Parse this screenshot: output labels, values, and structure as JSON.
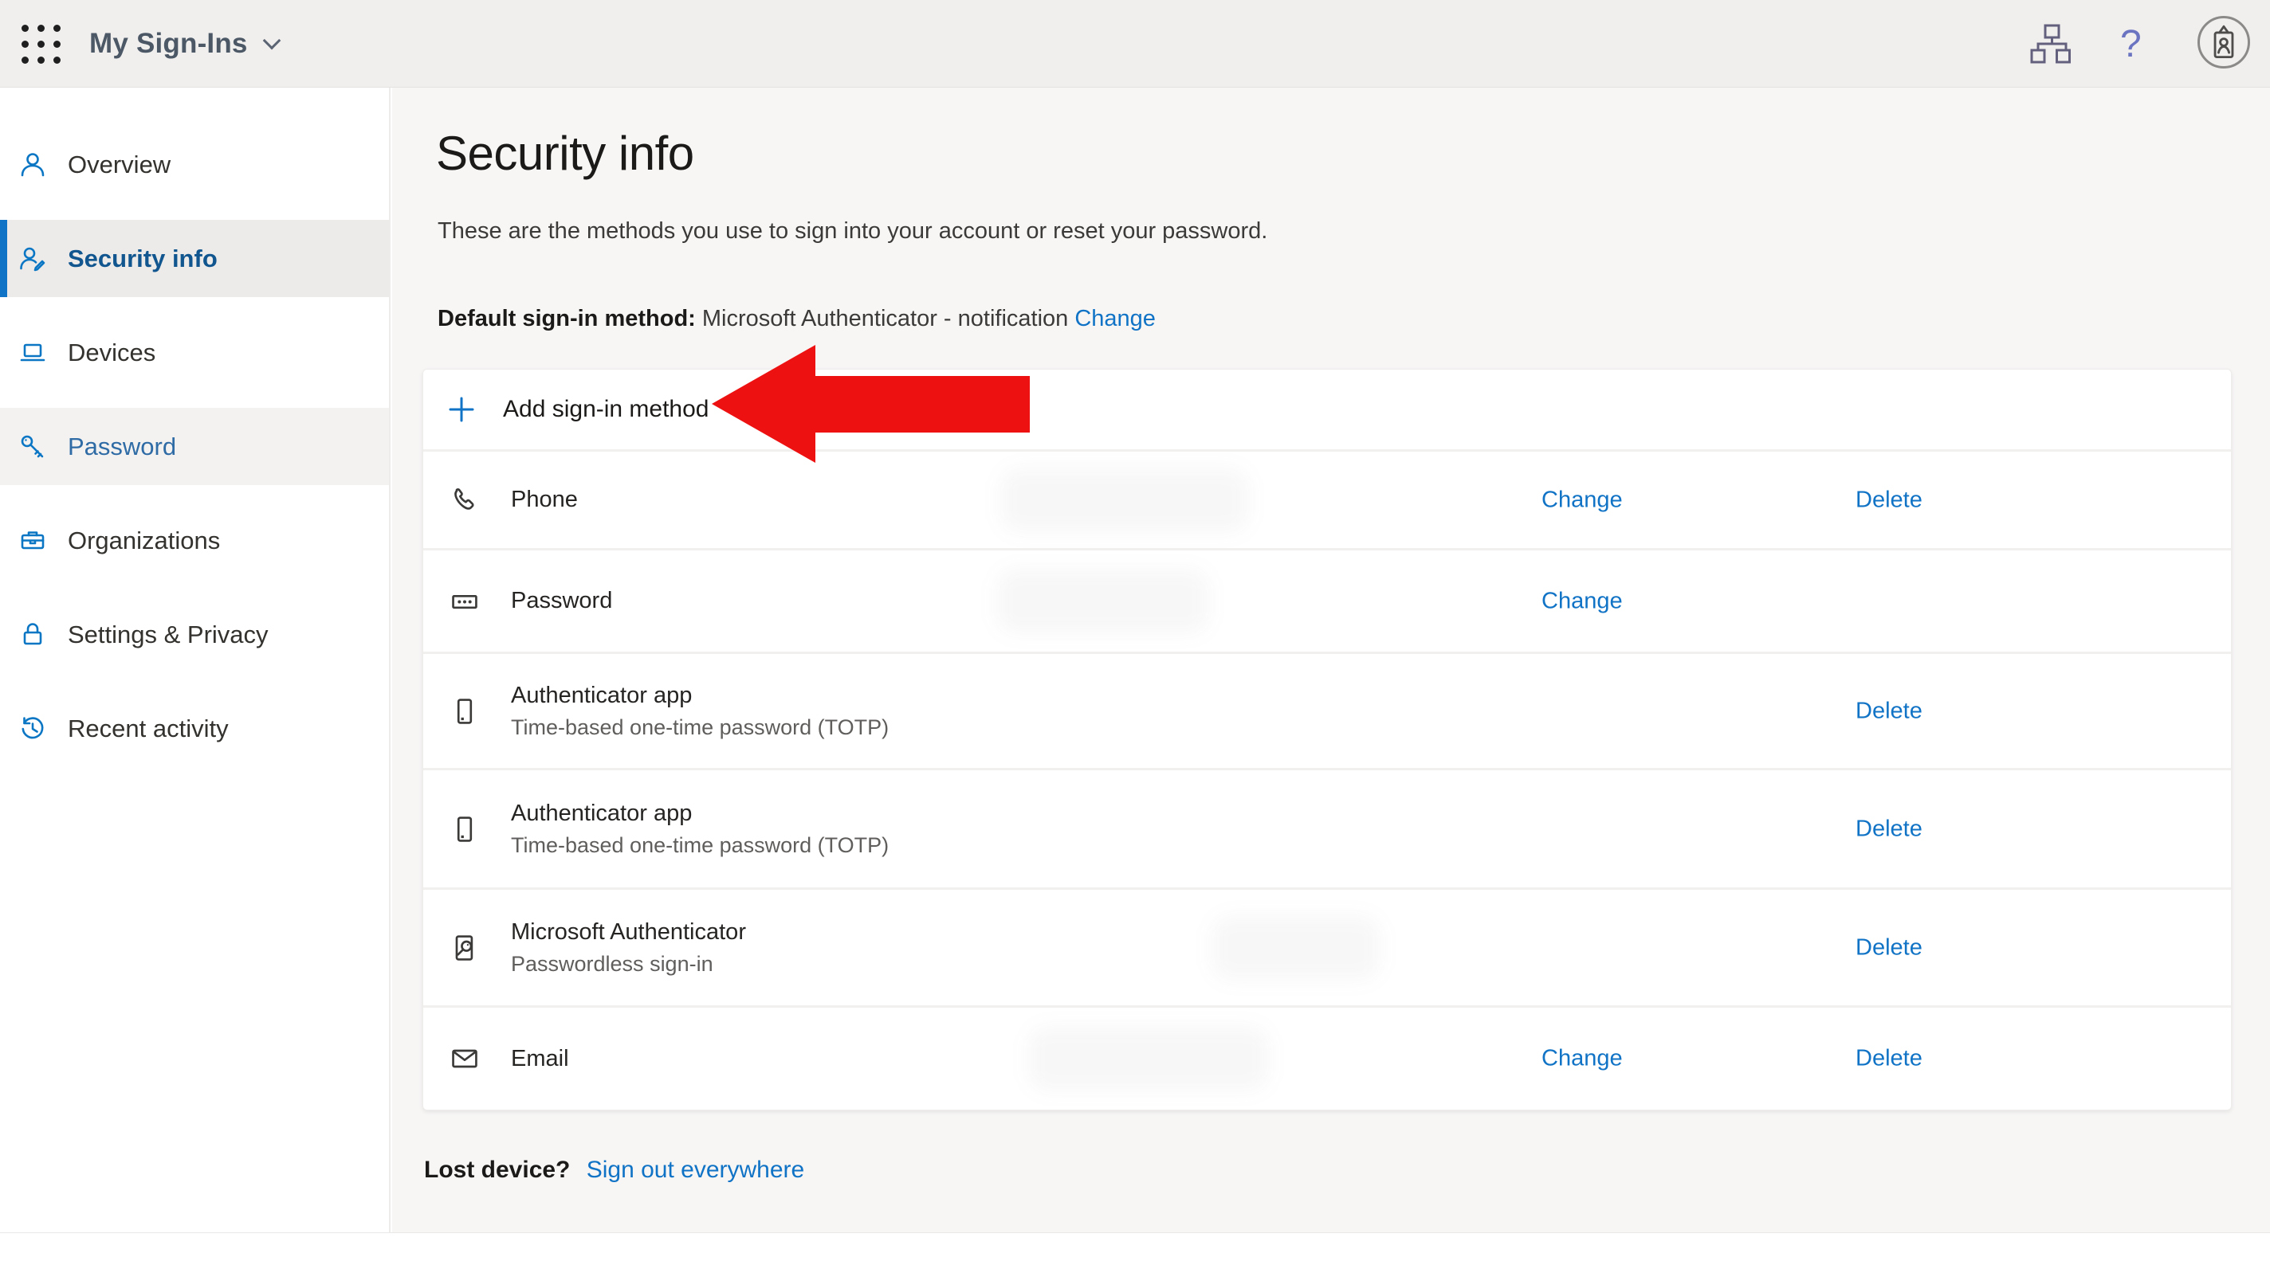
{
  "topbar": {
    "app_title": "My Sign-Ins",
    "icons": {
      "app_launcher": "grid-of-9-dots",
      "chevron": "chevron-down",
      "org_chart": "hierarchy-squares",
      "help": "?",
      "avatar": "id-badge-in-circle"
    }
  },
  "sidebar": {
    "items": [
      {
        "label": "Overview",
        "icon": "person-icon",
        "state": "normal"
      },
      {
        "label": "Security info",
        "icon": "person-key-icon",
        "state": "active"
      },
      {
        "label": "Devices",
        "icon": "laptop-icon",
        "state": "normal"
      },
      {
        "label": "Password",
        "icon": "key-icon",
        "state": "hovered"
      },
      {
        "label": "Organizations",
        "icon": "briefcase-icon",
        "state": "normal"
      },
      {
        "label": "Settings & Privacy",
        "icon": "lock-icon",
        "state": "normal"
      },
      {
        "label": "Recent activity",
        "icon": "history-icon",
        "state": "normal"
      }
    ]
  },
  "main": {
    "title": "Security info",
    "subtitle": "These are the methods you use to sign into your account or reset your password.",
    "default_line": {
      "label": "Default sign-in method:",
      "value": "Microsoft Authenticator - notification",
      "change_label": "Change"
    },
    "add_label": "Add sign-in method",
    "actions": {
      "change": "Change",
      "delete": "Delete"
    },
    "methods": [
      {
        "title": "Phone",
        "icon": "phone-icon",
        "actions": [
          "Change",
          "Delete"
        ],
        "value_redacted": true
      },
      {
        "title": "Password",
        "icon": "password-dots-icon",
        "actions": [
          "Change"
        ],
        "value_redacted": true
      },
      {
        "title": "Authenticator app",
        "subtitle": "Time-based one-time password (TOTP)",
        "icon": "mobile-phone-icon",
        "actions": [
          "Delete"
        ],
        "value_redacted": false
      },
      {
        "title": "Authenticator app",
        "subtitle": "Time-based one-time password (TOTP)",
        "icon": "mobile-phone-icon",
        "actions": [
          "Delete"
        ],
        "value_redacted": false
      },
      {
        "title": "Microsoft Authenticator",
        "subtitle": "Passwordless sign-in",
        "icon": "passwordless-device-icon",
        "actions": [
          "Delete"
        ],
        "value_redacted": true
      },
      {
        "title": "Email",
        "icon": "envelope-icon",
        "actions": [
          "Change",
          "Delete"
        ],
        "value_redacted": true
      }
    ],
    "lost_device": {
      "label": "Lost device?",
      "link_label": "Sign out everywhere"
    }
  },
  "annotation": {
    "type": "red-arrow-pointing-left",
    "target": "Add sign-in method"
  },
  "colors": {
    "accent_blue": "#1173c5",
    "sidebar_icon_blue": "#0b76c4",
    "arrow_red": "#ee1111",
    "topbar_bg": "#f0efee",
    "content_bg": "#f7f6f5",
    "active_item_bg": "#edebe9"
  }
}
